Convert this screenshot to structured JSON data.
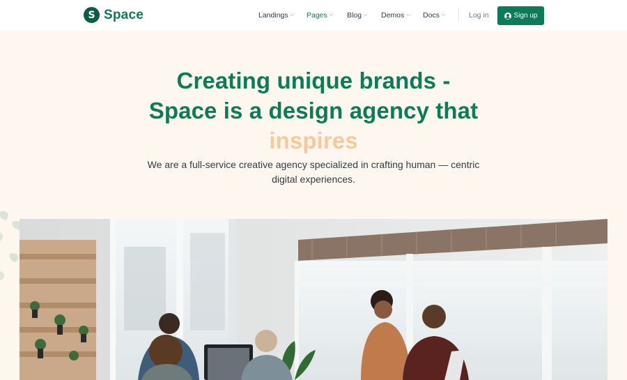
{
  "brand": {
    "logo_letter": "S",
    "name": "Space",
    "color": "#0d7a58"
  },
  "nav": {
    "items": [
      {
        "label": "Landings",
        "active": false
      },
      {
        "label": "Pages",
        "active": true
      },
      {
        "label": "Blog",
        "active": false
      },
      {
        "label": "Demos",
        "active": false
      },
      {
        "label": "Docs",
        "active": false
      }
    ],
    "login_label": "Log in",
    "signup_label": "Sign up",
    "signup_icon": "user-circle-icon"
  },
  "hero": {
    "title_line1": "Creating unique brands -",
    "title_line2": "Space is a design agency that",
    "title_accent": "inspires",
    "subtitle_line1": "We are a full-service creative agency specialized in crafting human — centric",
    "subtitle_line2": "digital experiences.",
    "background": "#fef7ef",
    "accent_color": "#f8c99a"
  },
  "photo": {
    "subject": "team-working-in-office-photo"
  }
}
